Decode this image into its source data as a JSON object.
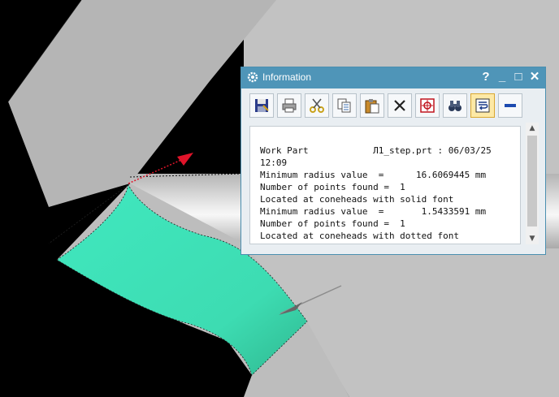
{
  "window": {
    "title": "Information",
    "help_label": "?",
    "minimize_label": "_",
    "maximize_label": "□",
    "close_label": "✕"
  },
  "toolbar": {
    "tools": [
      "save-icon",
      "print-icon",
      "cut-icon",
      "copy-icon",
      "paste-icon",
      "delete-icon",
      "target-icon",
      "binoculars-icon",
      "wrap-icon",
      "minus-icon"
    ],
    "active_tool": "wrap-icon"
  },
  "info_text": [
    "Work Part            Л1_step.prt : 06/03/25",
    "12:09",
    "Minimum radius value  =      16.6069445 mm",
    "Number of points found =  1",
    "Located at coneheads with solid font",
    "Minimum radius value  =       1.5433591 mm",
    "Number of points found =  1",
    "Located at coneheads with dotted font"
  ],
  "colors": {
    "titlebar": "#4f95b8",
    "face_highlight": "#3de3b8",
    "part_gray": "#b8b8b8",
    "arrow_red": "#e0142a"
  }
}
